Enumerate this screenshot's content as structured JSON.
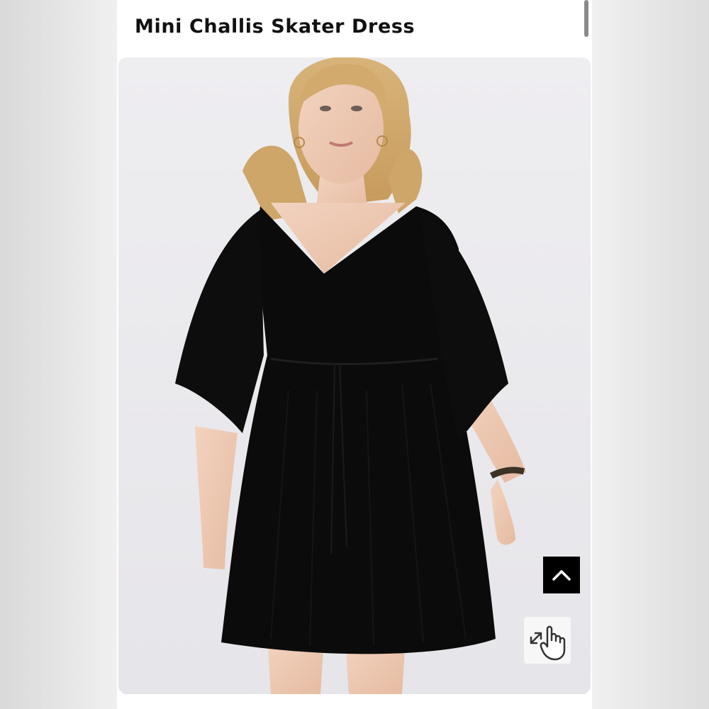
{
  "product": {
    "title": "Mini Challis Skater Dress"
  },
  "image": {
    "alt": "Model wearing black Mini Challis Skater Dress",
    "background_color": "#ecebee",
    "dress_color": "#0b0b0b"
  },
  "controls": {
    "back_to_top_icon": "chevron-up-icon",
    "zoom_icon": "hand-pointer-expand-icon"
  },
  "colors": {
    "title_text": "#111111",
    "button_bg": "#000000"
  }
}
